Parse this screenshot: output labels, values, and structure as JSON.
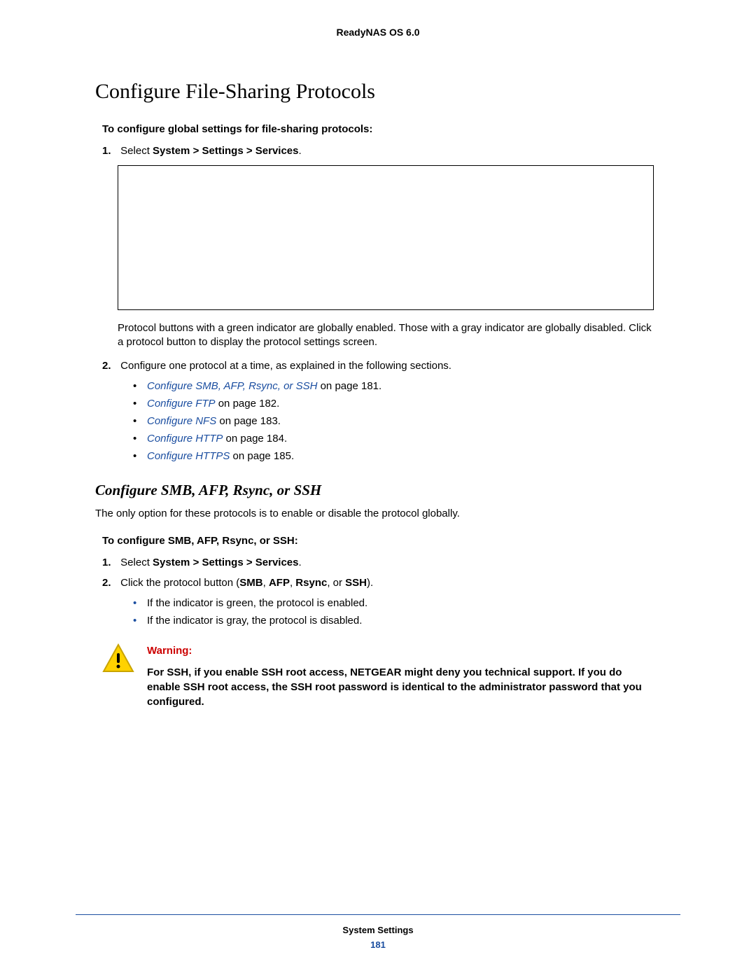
{
  "header": {
    "product": "ReadyNAS OS 6.0"
  },
  "heading": "Configure File-Sharing Protocols",
  "intro_bold": "To configure global settings for file-sharing protocols:",
  "step1": {
    "num": "1.",
    "pre": "Select ",
    "bold": "System > Settings > Services",
    "post": "."
  },
  "after_image": "Protocol buttons with a green indicator are globally enabled. Those with a gray indicator are globally disabled. Click a protocol button to display the protocol settings screen.",
  "step2": {
    "num": "2.",
    "text": "Configure one protocol at a time, as explained in the following sections."
  },
  "links": [
    {
      "link": "Configure SMB, AFP, Rsync, or SSH",
      "tail": " on page 181."
    },
    {
      "link": "Configure FTP",
      "tail": " on page 182."
    },
    {
      "link": "Configure NFS",
      "tail": " on page 183."
    },
    {
      "link": "Configure HTTP",
      "tail": " on page 184."
    },
    {
      "link": "Configure HTTPS",
      "tail": " on page 185."
    }
  ],
  "subheading": "Configure SMB, AFP, Rsync, or SSH",
  "sub_intro": "The only option for these protocols is to enable or disable the protocol globally.",
  "sub_bold": "To configure SMB, AFP, Rsync, or SSH:",
  "sub_step1": {
    "num": "1.",
    "pre": "Select ",
    "bold": "System > Settings > Services",
    "post": "."
  },
  "sub_step2": {
    "num": "2.",
    "pre": "Click the protocol button (",
    "b1": "SMB",
    "c1": ", ",
    "b2": "AFP",
    "c2": ", ",
    "b3": "Rsync",
    "c3": ", or ",
    "b4": "SSH",
    "post": ")."
  },
  "sub_bullets": [
    "If the indicator is green, the protocol is enabled.",
    "If the indicator is gray, the protocol is disabled."
  ],
  "warning": {
    "label": "Warning:",
    "body": "For SSH, if you enable SSH root access, NETGEAR might deny you technical support. If you do enable SSH root access, the SSH root password is identical to the administrator password that you configured."
  },
  "footer": {
    "section": "System Settings",
    "page": "181"
  }
}
